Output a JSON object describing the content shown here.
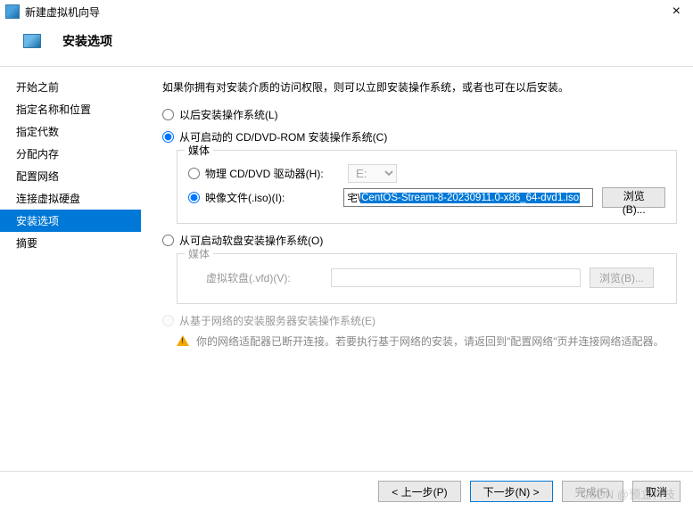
{
  "window": {
    "title": "新建虚拟机向导"
  },
  "header": {
    "heading": "安装选项"
  },
  "sidebar": {
    "items": [
      {
        "label": "开始之前"
      },
      {
        "label": "指定名称和位置"
      },
      {
        "label": "指定代数"
      },
      {
        "label": "分配内存"
      },
      {
        "label": "配置网络"
      },
      {
        "label": "连接虚拟硬盘"
      },
      {
        "label": "安装选项"
      },
      {
        "label": "摘要"
      }
    ],
    "selected_index": 6
  },
  "content": {
    "intro": "如果你拥有对安装介质的访问权限，则可以立即安装操作系统，或者也可在以后安装。",
    "options": {
      "later": "以后安装操作系统(L)",
      "cd": "从可启动的 CD/DVD-ROM 安装操作系统(C)",
      "floppy": "从可启动软盘安装操作系统(O)",
      "network": "从基于网络的安装服务器安装操作系统(E)"
    },
    "cd": {
      "legend": "媒体",
      "phys_label": "物理 CD/DVD 驱动器(H):",
      "phys_value": "E:",
      "iso_label": "映像文件(.iso)(I):",
      "iso_prefix": "宅\\",
      "iso_selected": "CentOS-Stream-8-20230911.0-x86_64-dvd1.iso",
      "browse": "浏览(B)..."
    },
    "floppy": {
      "legend": "媒体",
      "vfd_label": "虚拟软盘(.vfd)(V):",
      "browse": "浏览(B)..."
    },
    "network_warning": "你的网络适配器已断开连接。若要执行基于网络的安装，请返回到\"配置网络\"页并连接网络适配器。"
  },
  "footer": {
    "prev": "< 上一步(P)",
    "next": "下一步(N) >",
    "finish": "完成(F)",
    "cancel": "取消"
  },
  "watermark": "CSDN @预立科技"
}
